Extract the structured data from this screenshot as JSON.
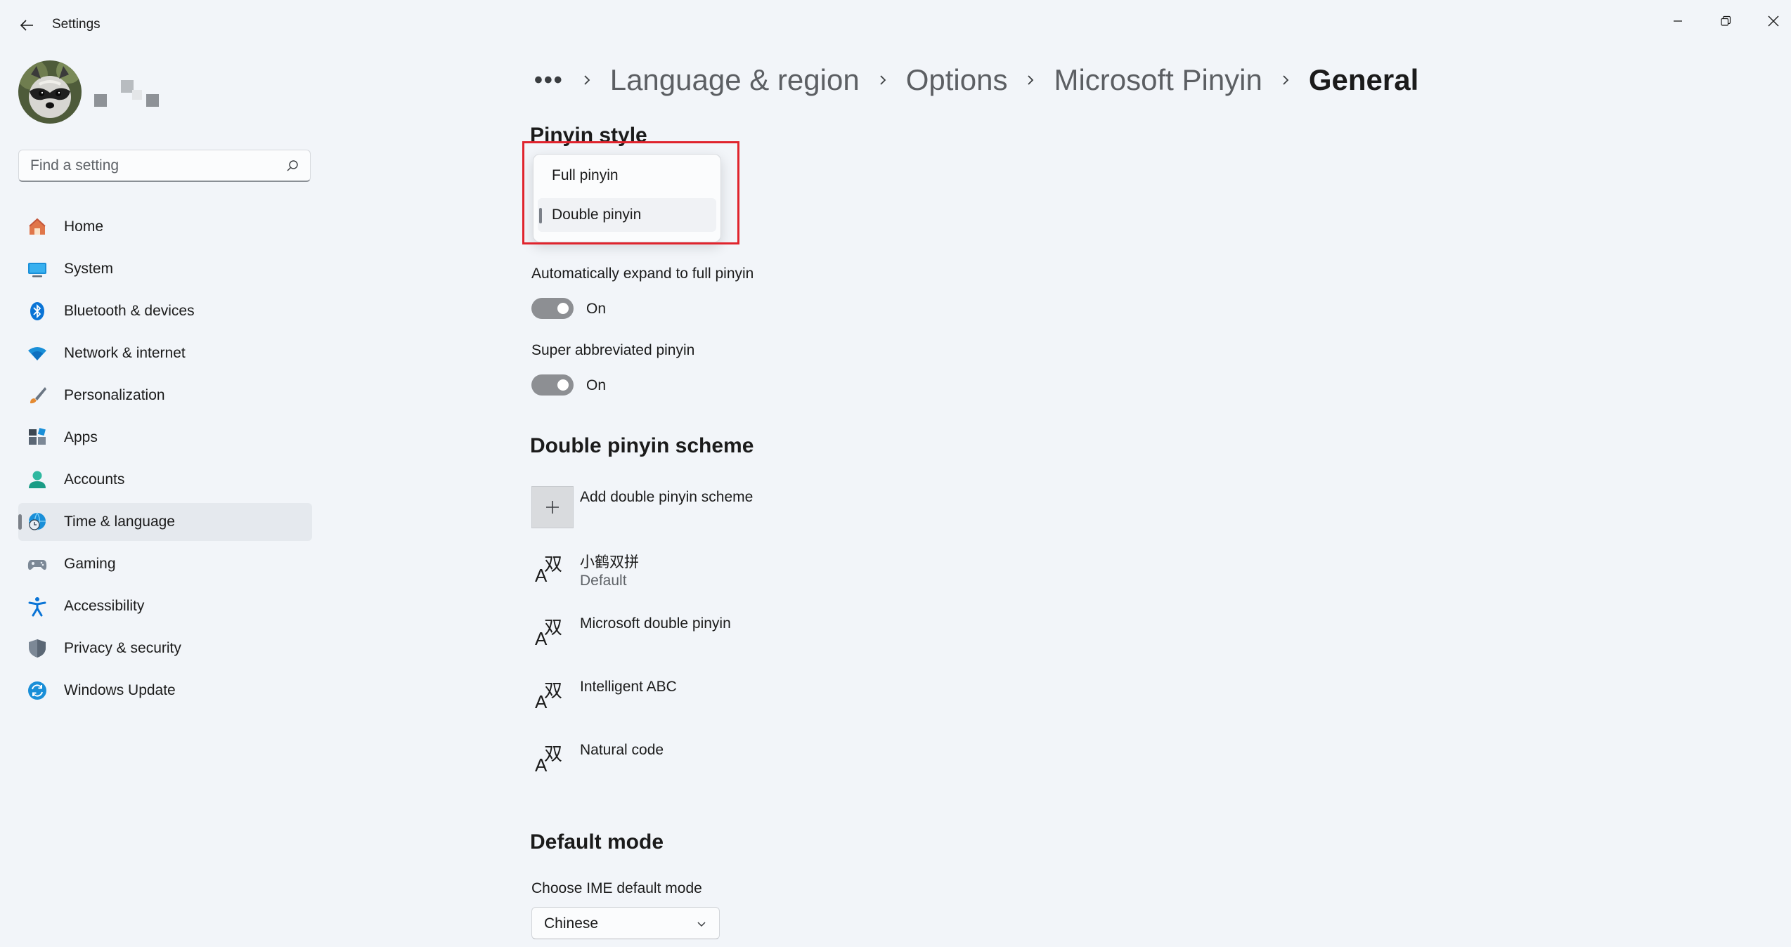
{
  "window": {
    "title": "Settings"
  },
  "search": {
    "placeholder": "Find a setting"
  },
  "nav": {
    "items": [
      {
        "label": "Home",
        "icon": "home-icon"
      },
      {
        "label": "System",
        "icon": "monitor-icon"
      },
      {
        "label": "Bluetooth & devices",
        "icon": "bluetooth-icon"
      },
      {
        "label": "Network & internet",
        "icon": "wifi-icon"
      },
      {
        "label": "Personalization",
        "icon": "brush-icon"
      },
      {
        "label": "Apps",
        "icon": "apps-icon"
      },
      {
        "label": "Accounts",
        "icon": "person-icon"
      },
      {
        "label": "Time & language",
        "icon": "globe-clock-icon",
        "selected": true
      },
      {
        "label": "Gaming",
        "icon": "gamepad-icon"
      },
      {
        "label": "Accessibility",
        "icon": "accessibility-icon"
      },
      {
        "label": "Privacy & security",
        "icon": "shield-icon"
      },
      {
        "label": "Windows Update",
        "icon": "update-icon"
      }
    ]
  },
  "breadcrumb": {
    "more": "•••",
    "items": [
      "Language & region",
      "Options",
      "Microsoft Pinyin"
    ],
    "current": "General"
  },
  "pinyin_style": {
    "title": "Pinyin style",
    "options": [
      "Full pinyin",
      "Double pinyin"
    ],
    "selected": "Double pinyin"
  },
  "auto_expand": {
    "label": "Automatically expand to full pinyin",
    "state": "On"
  },
  "super_abbrev": {
    "label": "Super abbreviated pinyin",
    "state": "On"
  },
  "double_scheme": {
    "title": "Double pinyin scheme",
    "add_label": "Add double pinyin scheme",
    "schemes": [
      {
        "name": "小鹤双拼",
        "sub": "Default"
      },
      {
        "name": "Microsoft double pinyin"
      },
      {
        "name": "Intelligent ABC"
      },
      {
        "name": "Natural code"
      }
    ]
  },
  "default_mode": {
    "title": "Default mode",
    "label": "Choose IME default mode",
    "value": "Chinese"
  },
  "colors": {
    "background": "#f2f5f9",
    "toggle_on": "#8d8f93",
    "highlight_box": "#e0242d",
    "accent_blue": "#0a74d6"
  }
}
